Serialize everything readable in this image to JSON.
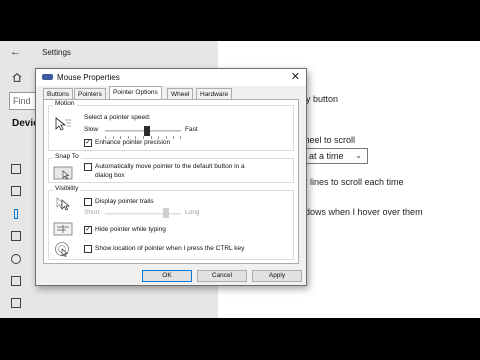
{
  "settings": {
    "window_title": "Settings",
    "search_placeholder": "Find",
    "section_heading": "Devices",
    "right_lines": {
      "primary_button": "ary button",
      "wheel": "wheel to scroll",
      "select_value": "at a time",
      "lines": "ny lines to scroll each time",
      "inactive": "indows when I hover over them"
    }
  },
  "dialog": {
    "title": "Mouse Properties",
    "close_label": "✕",
    "tabs": [
      "Buttons",
      "Pointers",
      "Pointer Options",
      "Wheel",
      "Hardware"
    ],
    "active_tab": "Pointer Options",
    "motion": {
      "group_label": "Motion",
      "speed_label": "Select a pointer speed:",
      "slow": "Slow",
      "fast": "Fast",
      "speed_position": 0.55,
      "enhance_label": "Enhance pointer precision",
      "enhance_checked": true
    },
    "snap_to": {
      "group_label": "Snap To",
      "auto_move_label": "Automatically move pointer to the default button in a",
      "auto_move_label_2": "dialog box",
      "checked": false
    },
    "visibility": {
      "group_label": "Visibility",
      "trails_label": "Display pointer trails",
      "trails_checked": false,
      "short": "Short",
      "long": "Long",
      "trail_position": 0.8,
      "hide_label": "Hide pointer while typing",
      "hide_checked": true,
      "ctrl_label": "Show location of pointer when I press the CTRL key",
      "ctrl_checked": false
    },
    "buttons": {
      "ok": "OK",
      "cancel": "Cancel",
      "apply": "Apply"
    }
  },
  "colors": {
    "accent": "#0078d7",
    "titlebar": "#ffffff",
    "dialog_bg": "#f0f0f0",
    "settings_left_bg": "#e6e6e6"
  }
}
